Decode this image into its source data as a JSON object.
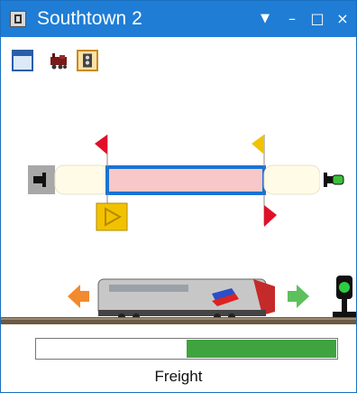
{
  "window": {
    "title": "Southtown 2"
  },
  "titlebar": {
    "menu_glyph": "▼",
    "minimize_glyph": "–",
    "maximize_glyph": "□",
    "close_glyph": "×"
  },
  "toolbar": {
    "items": [
      {
        "icon": "window-icon"
      },
      {
        "icon": "locomotive-icon"
      },
      {
        "icon": "signal-panel-icon"
      }
    ]
  },
  "colors": {
    "titlebar": "#1f7dd6",
    "track_selected_fill": "#f8c8c8",
    "track_selected_border": "#1a73d4",
    "track_fill": "#fffbe6",
    "signal_red": "#e0102a",
    "signal_yellow": "#f2c200",
    "arrow_orange": "#f28a2e",
    "arrow_green": "#5cc05c",
    "progress_fill": "#3fa43f"
  },
  "train": {
    "progress_fraction": 0.5
  },
  "status": {
    "label": "Freight"
  }
}
